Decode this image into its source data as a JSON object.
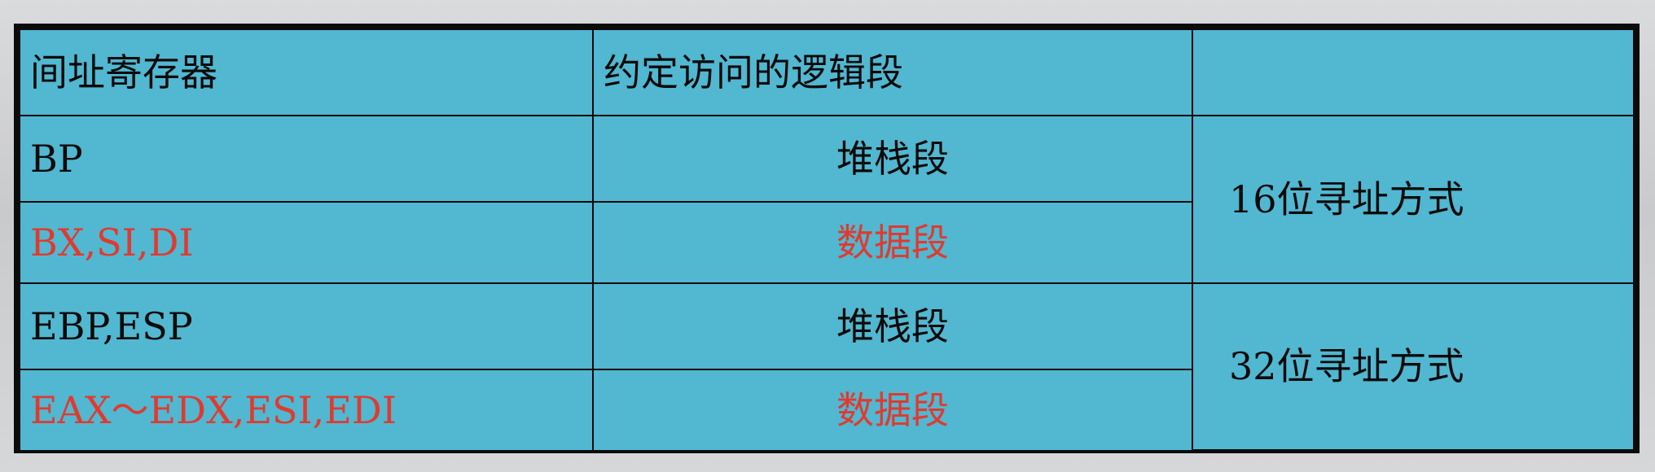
{
  "table": {
    "headers": [
      "间址寄存器",
      "约定访问的逻辑段",
      ""
    ],
    "rows": [
      {
        "register": "BP",
        "segment": "堆栈段",
        "highlight": false
      },
      {
        "register": "BX,SI,DI",
        "segment": "数据段",
        "highlight": true
      },
      {
        "register": "EBP,ESP",
        "segment": "堆栈段",
        "highlight": false
      },
      {
        "register": "EAX～EDX,ESI,EDI",
        "segment": "数据段",
        "highlight": true
      }
    ],
    "modes": [
      "16位寻址方式",
      "32位寻址方式"
    ]
  },
  "colors": {
    "cell_background": "#52b7d0",
    "border": "#0b0b0b",
    "text": "#0a0a0a",
    "highlight_text": "#e03a2f"
  }
}
